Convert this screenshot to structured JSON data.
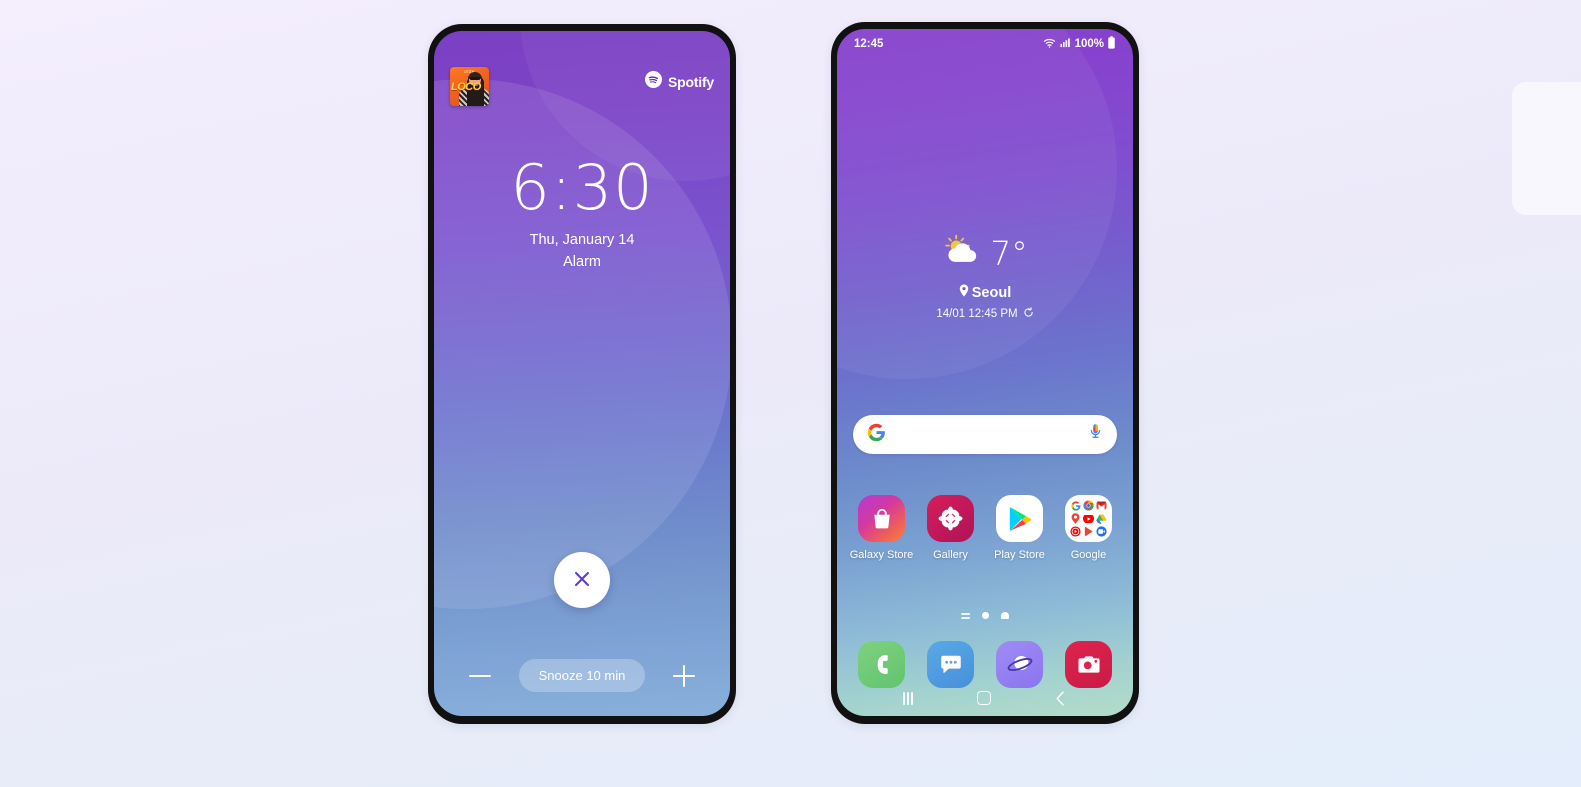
{
  "background": {
    "gradient_from": "#f4eefd",
    "gradient_to": "#e3edfb"
  },
  "lock_screen": {
    "device_label": "Galaxy phone lock screen",
    "wallpaper_colors": [
      "#7c3fc4",
      "#7065cd",
      "#89b0dc"
    ],
    "media": {
      "app_name": "Spotify",
      "album_title": "LOCO",
      "album_artist": "ITZY",
      "album_art_name": "spotify-album-art"
    },
    "clock": {
      "time": "6:30",
      "date": "Thu, January 14"
    },
    "alarm_label": "Alarm",
    "dismiss": {
      "label": "Dismiss alarm",
      "icon": "close-icon",
      "icon_color": "#5b3fc7"
    },
    "snooze": {
      "label": "Snooze 10 min",
      "decrease_label": "Decrease snooze time",
      "increase_label": "Increase snooze time"
    }
  },
  "home_screen": {
    "device_label": "Galaxy phone home screen",
    "wallpaper_colors": [
      "#8640cc",
      "#6b75cc",
      "#b3dcc9"
    ],
    "status_bar": {
      "time": "12:45",
      "wifi": "wifi-icon",
      "signal": "cellular-signal-icon",
      "battery_percent": "100%",
      "battery_icon": "battery-full-icon"
    },
    "weather": {
      "icon": "partly-cloudy-icon",
      "temperature": "7°",
      "city": "Seoul",
      "updated": "14/01 12:45 PM",
      "refresh_icon": "refresh-icon"
    },
    "search": {
      "placeholder": "",
      "value": "",
      "logo_icon": "google-g-icon",
      "mic_icon": "microphone-icon"
    },
    "apps": [
      {
        "label": "Galaxy Store",
        "icon": "galaxy-store-icon"
      },
      {
        "label": "Gallery",
        "icon": "gallery-icon"
      },
      {
        "label": "Play Store",
        "icon": "play-store-icon"
      },
      {
        "label": "Google",
        "icon": "google-folder-icon"
      }
    ],
    "google_folder": [
      {
        "name": "google-search-icon",
        "color": "#ffffff"
      },
      {
        "name": "chrome-icon",
        "color": "#ffffff"
      },
      {
        "name": "gmail-icon",
        "color": "#ffffff"
      },
      {
        "name": "maps-icon",
        "color": "#ffffff"
      },
      {
        "name": "youtube-icon",
        "color": "#ffffff"
      },
      {
        "name": "drive-icon",
        "color": "#ffffff"
      },
      {
        "name": "youtube-music-icon",
        "color": "#ffffff"
      },
      {
        "name": "play-icon",
        "color": "#ffffff"
      },
      {
        "name": "duo-icon",
        "color": "#ffffff"
      }
    ],
    "page_indicator": {
      "items": [
        "app-list-indicator",
        "home-page-dot",
        "home-indicator"
      ],
      "active_index": 1
    },
    "dock": [
      {
        "label": "Phone",
        "icon": "phone-icon"
      },
      {
        "label": "Messages",
        "icon": "messages-icon"
      },
      {
        "label": "Internet",
        "icon": "internet-icon"
      },
      {
        "label": "Camera",
        "icon": "camera-icon"
      }
    ],
    "nav_bar": [
      {
        "label": "Recents",
        "icon": "recents-icon"
      },
      {
        "label": "Home",
        "icon": "home-icon"
      },
      {
        "label": "Back",
        "icon": "back-icon"
      }
    ]
  }
}
